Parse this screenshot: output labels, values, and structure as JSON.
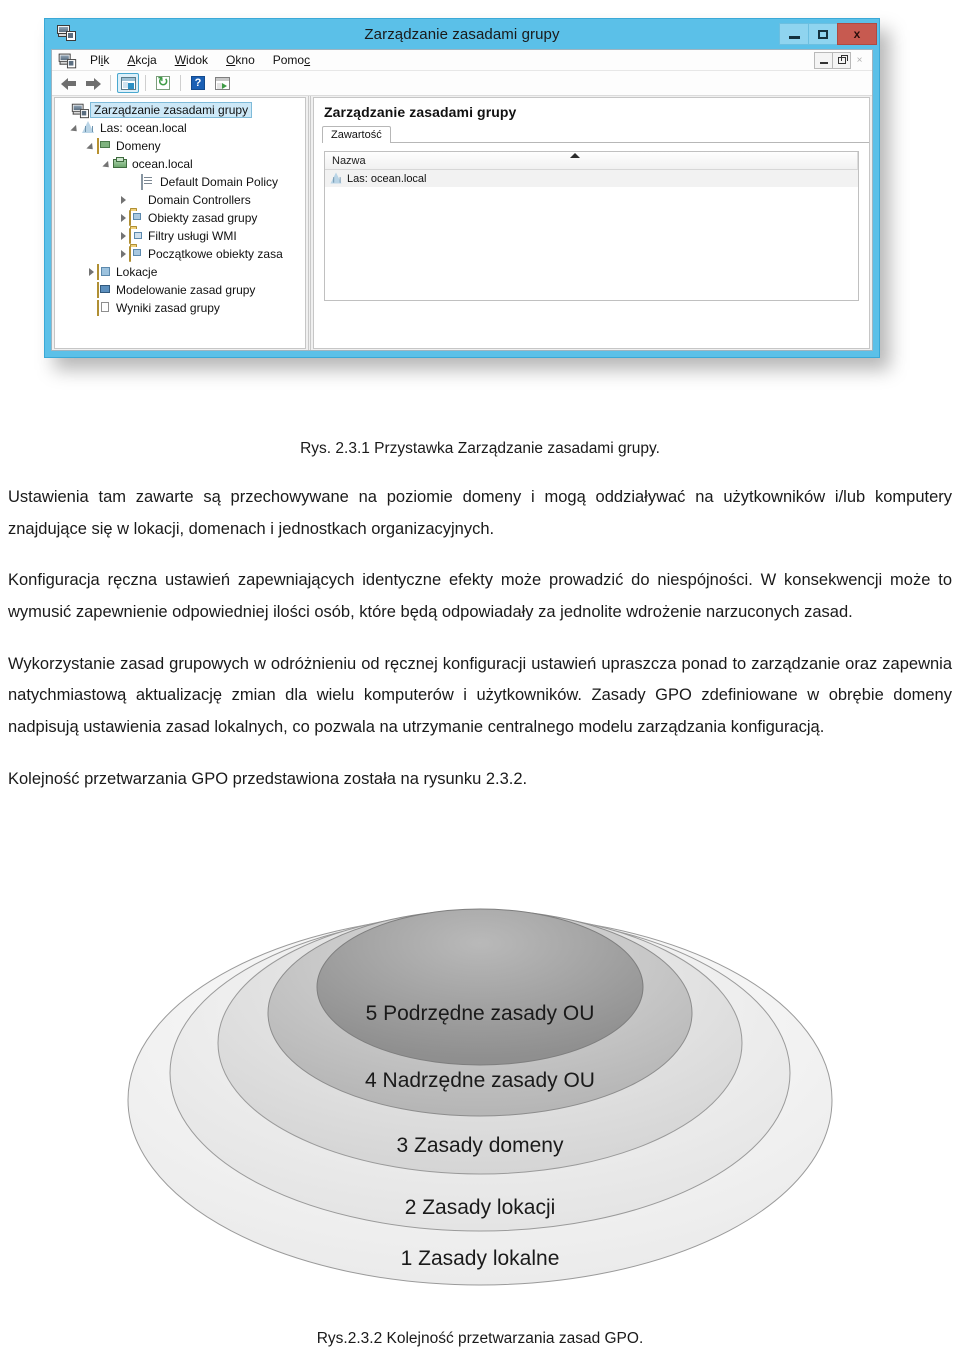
{
  "window": {
    "title": "Zarządzanie zasadami grupy",
    "titlebar_color": "#5bc0e8",
    "close_color": "#c75a50",
    "buttons": {
      "minimize": "minimize-icon",
      "maximize": "maximize-icon",
      "close": "x"
    },
    "mdi_buttons": {
      "minimize": "minimize-icon",
      "restore": "restore-icon",
      "close": "×"
    },
    "menu": [
      {
        "label": "Plik",
        "mnemonic": "i",
        "pre": "Pl",
        "post": "k"
      },
      {
        "label": "Akcja",
        "mnemonic": "A",
        "pre": "",
        "post": "kcja"
      },
      {
        "label": "Widok",
        "mnemonic": "W",
        "pre": "",
        "post": "idok"
      },
      {
        "label": "Okno",
        "mnemonic": "O",
        "pre": "",
        "post": "kno"
      },
      {
        "label": "Pomoc",
        "mnemonic": "c",
        "pre": "Pomo",
        "post": ""
      }
    ],
    "toolbar": [
      {
        "name": "back-icon",
        "tooltip": "Wstecz"
      },
      {
        "name": "forward-icon",
        "tooltip": "Dalej"
      },
      {
        "name": "show-hide-tree-icon",
        "tooltip": "Pokaż/ukryj drzewo konsoli",
        "active": true
      },
      {
        "name": "refresh-icon",
        "tooltip": "Odśwież"
      },
      {
        "name": "help-icon",
        "tooltip": "Pomoc"
      },
      {
        "name": "export-list-icon",
        "tooltip": "Eksportuj listę"
      }
    ]
  },
  "tree": {
    "items": [
      {
        "label": "Zarządzanie zasadami grupy",
        "indent": 0,
        "icon": "mmc-console-icon",
        "expander": "none",
        "selected": true
      },
      {
        "label": "Las: ocean.local",
        "indent": 1,
        "icon": "forest-icon",
        "expander": "open",
        "selected": false
      },
      {
        "label": "Domeny",
        "indent": 2,
        "icon": "domains-folder-icon",
        "expander": "open",
        "selected": false
      },
      {
        "label": "ocean.local",
        "indent": 3,
        "icon": "domain-icon",
        "expander": "open",
        "selected": false
      },
      {
        "label": "Default Domain Policy",
        "indent": 4,
        "icon": "gpo-icon",
        "expander": "none",
        "selected": false
      },
      {
        "label": "Domain Controllers",
        "indent": 4,
        "icon": "ou-folder-icon",
        "expander": "closed",
        "selected": false
      },
      {
        "label": "Obiekty zasad grupy",
        "indent": 4,
        "icon": "gpo-folder-icon",
        "expander": "closed",
        "selected": false
      },
      {
        "label": "Filtry usługi WMI",
        "indent": 4,
        "icon": "wmi-folder-icon",
        "expander": "closed",
        "selected": false
      },
      {
        "label": "Początkowe obiekty zasa",
        "indent": 4,
        "icon": "starter-gpo-folder-icon",
        "expander": "closed",
        "selected": false
      },
      {
        "label": "Lokacje",
        "indent": 2,
        "icon": "sites-folder-icon",
        "expander": "closed",
        "selected": false
      },
      {
        "label": "Modelowanie zasad grupy",
        "indent": 2,
        "icon": "modeling-icon",
        "expander": "none",
        "selected": false
      },
      {
        "label": "Wyniki zasad grupy",
        "indent": 2,
        "icon": "results-icon",
        "expander": "none",
        "selected": false
      }
    ]
  },
  "detail": {
    "title": "Zarządzanie zasadami grupy",
    "tabs": [
      {
        "label": "Zawartość",
        "active": true
      }
    ],
    "list": {
      "columns": [
        "Nazwa"
      ],
      "sort": "ascending",
      "rows": [
        {
          "name": "Las: ocean.local",
          "icon": "forest-icon"
        }
      ]
    }
  },
  "document": {
    "figure_caption_1": "Rys. 2.3.1 Przystawka Zarządzanie zasadami grupy.",
    "paragraphs": [
      "Ustawienia tam zawarte są przechowywane na poziomie domeny i mogą oddziaływać na użytkowników i/lub komputery znajdujące się w lokacji, domenach i jednostkach organizacyjnych.",
      "Konfiguracja ręczna ustawień zapewniających identyczne efekty może prowadzić do niespójności. W konsekwencji może to wymusić zapewnienie odpowiedniej ilości osób, które będą odpowiadały za jednolite wdrożenie narzuconych zasad.",
      "Wykorzystanie zasad grupowych w odróżnieniu od ręcznej konfiguracji ustawień upraszcza ponad to zarządzanie oraz zapewnia natychmiastową aktualizację zmian dla wielu komputerów i użytkowników. Zasady GPO zdefiniowane w obrębie domeny nadpisują ustawienia zasad lokalnych, co pozwala na utrzymanie centralnego modelu zarządzania konfiguracją.",
      "Kolejność przetwarzania GPO przedstawiona została na rysunku 2.3.2."
    ],
    "figure_caption_2": "Rys.2.3.2 Kolejność przetwarzania zasad GPO."
  },
  "diagram": {
    "type": "nested-ellipses",
    "title": "Kolejność przetwarzania zasad GPO",
    "layers": [
      {
        "order": 1,
        "label": "1 Zasady lokalne",
        "fill": "#f5f5f5"
      },
      {
        "order": 2,
        "label": "2 Zasady lokacji",
        "fill": "#ededed"
      },
      {
        "order": 3,
        "label": "3 Zasady domeny",
        "fill": "#e0e0e0"
      },
      {
        "order": 4,
        "label": "4 Nadrzędne zasady OU",
        "fill": "#c6c6c6"
      },
      {
        "order": 5,
        "label": "5 Podrzędne zasady OU",
        "fill": "#a5a5a5"
      }
    ]
  }
}
